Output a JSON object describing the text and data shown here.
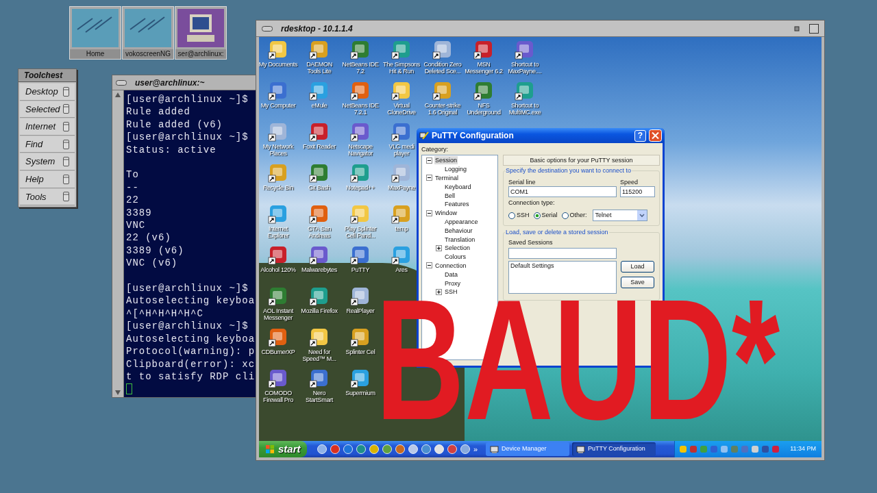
{
  "workspace_icons": [
    {
      "label": "Home",
      "kind": "landscape"
    },
    {
      "label": "vokoscreenNG",
      "kind": "landscape"
    },
    {
      "label": "ser@archlinux:",
      "kind": "computer"
    }
  ],
  "toolchest": {
    "title": "Toolchest",
    "items": [
      "Desktop",
      "Selected",
      "Internet",
      "Find",
      "System",
      "Help",
      "Tools"
    ]
  },
  "terminal": {
    "title": "user@archlinux:~",
    "blocks": [
      [
        "[user@archlinux ~]$",
        "Rule added",
        "Rule added (v6)",
        "[user@archlinux ~]$",
        "Status: active"
      ],
      [
        "To",
        "--",
        "22",
        "3389",
        "VNC",
        "22 (v6)",
        "3389 (v6)",
        "VNC (v6)"
      ],
      [
        "[user@archlinux ~]$",
        "Autoselecting keyboa",
        "^[^H^H^H^H^C",
        "[user@archlinux ~]$",
        "Autoselecting keyboa",
        "Protocol(warning): p",
        "Clipboard(error): xc",
        "t to satisfy RDP cli"
      ]
    ]
  },
  "rdesktop": {
    "title": "rdesktop - 10.1.1.4",
    "desktop_columns": [
      [
        "My Documents",
        "My Computer",
        "My Network Places",
        "Recycle Bin",
        "Internet Explorer",
        "Alcohol 120%",
        "AOL Instant Messenger",
        "CDBurnerXP",
        "COMODO Firewall Pro"
      ],
      [
        "DAEMON Tools Lite",
        "eMule",
        "Foxit Reader",
        "Git Bash",
        "GTA San Andreas",
        "Malwarebytes",
        "Mozilla Firefox",
        "Need for Speed™ M...",
        "Nero StartSmart"
      ],
      [
        "NetBeans IDE 7.2",
        "NetBeans IDE 7.2.1",
        "Netscape Navigator",
        "Notepad++",
        "Play Splinter Cell Pand...",
        "PuTTY",
        "RealPlayer",
        "Splinter Cel",
        "Supermium"
      ],
      [
        "The Simpsons Hit & Run",
        "Virtual CloneDrive",
        "VLC medi player",
        "MaxPayne",
        "temp",
        "Ares"
      ],
      [
        "Condition Zero Deleted Sce...",
        "Counter-strike 1.6 Original"
      ],
      [
        "MSN Messenger 6.2",
        "NFS Underground"
      ],
      [
        "Shortcut to MaxPayne....",
        "Shortcut to MultiMC.exe"
      ]
    ],
    "putty": {
      "title": "PuTTY Configuration",
      "help": "?",
      "category_label": "Category:",
      "tree": [
        {
          "label": "Session",
          "selected": true,
          "expanded": true,
          "children": [
            {
              "label": "Logging",
              "selected": false
            }
          ]
        },
        {
          "label": "Terminal",
          "selected": false,
          "expanded": true,
          "children": [
            {
              "label": "Keyboard",
              "selected": false
            },
            {
              "label": "Bell",
              "selected": false
            },
            {
              "label": "Features",
              "selected": false
            }
          ]
        },
        {
          "label": "Window",
          "selected": false,
          "expanded": true,
          "children": [
            {
              "label": "Appearance",
              "selected": false
            },
            {
              "label": "Behaviour",
              "selected": false
            },
            {
              "label": "Translation",
              "selected": false
            },
            {
              "label": "Selection",
              "selected": false,
              "expanded": false
            },
            {
              "label": "Colours",
              "selected": false
            }
          ]
        },
        {
          "label": "Connection",
          "selected": false,
          "expanded": true,
          "children": [
            {
              "label": "Data",
              "selected": false
            },
            {
              "label": "Proxy",
              "selected": false
            },
            {
              "label": "SSH",
              "selected": false,
              "expanded": false
            }
          ]
        }
      ],
      "panel_title": "Basic options for your PuTTY session",
      "destination_group": "Specify the destination you want to connect to",
      "serial_line": {
        "label": "Serial line",
        "value": "COM1"
      },
      "speed": {
        "label": "Speed",
        "value": "115200"
      },
      "connection_type": {
        "label": "Connection type:",
        "options": [
          {
            "label": "SSH",
            "selected": false
          },
          {
            "label": "Serial",
            "selected": true
          },
          {
            "label": "Other:",
            "selected": false
          }
        ],
        "other_protocol": "Telnet"
      },
      "sessions_group": "Load, save or delete a stored session",
      "saved_sessions": {
        "label": "Saved Sessions",
        "list": [
          "Default Settings"
        ]
      },
      "buttons": [
        "Load",
        "Save"
      ]
    },
    "taskbar": {
      "start": "start",
      "chevron": "»",
      "tasks": [
        {
          "label": "Device Manager",
          "selected": false
        },
        {
          "label": "PuTTY Configuration",
          "selected": true
        }
      ],
      "clock": "11:34 PM"
    }
  },
  "overlay": {
    "text": "BAUD*"
  }
}
